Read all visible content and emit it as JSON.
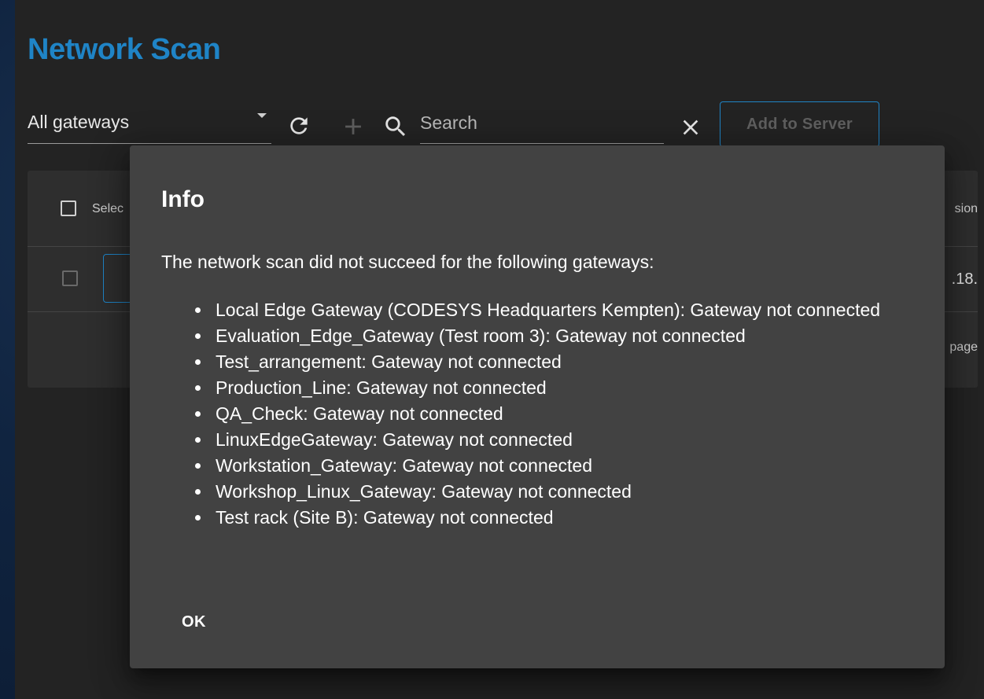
{
  "page": {
    "title": "Network Scan"
  },
  "toolbar": {
    "gateway_filter": "All gateways",
    "search_placeholder": "Search",
    "add_to_server_label": "Add to Server",
    "icons": [
      "refresh-icon",
      "add-icon",
      "search-icon",
      "close-icon",
      "chevron-down-icon"
    ]
  },
  "table": {
    "header_select_label": "Selec",
    "header_version_label": "sion",
    "row_version_value": ".18.",
    "footer_page_label": "page"
  },
  "dialog": {
    "title": "Info",
    "message": "The network scan did not succeed for the following gateways:",
    "items": [
      "Local Edge Gateway (CODESYS Headquarters Kempten): Gateway not connected",
      "Evaluation_Edge_Gateway (Test room 3): Gateway not connected",
      "Test_arrangement: Gateway not connected",
      "Production_Line: Gateway not connected",
      "QA_Check: Gateway not connected",
      "LinuxEdgeGateway: Gateway not connected",
      "Workstation_Gateway: Gateway not connected",
      "Workshop_Linux_Gateway: Gateway not connected",
      "Test rack (Site B): Gateway not connected"
    ],
    "ok_label": "OK"
  },
  "colors": {
    "accent": "#1f84c6",
    "panel_bg": "#232323",
    "dialog_bg": "#424242",
    "table_bg": "#2e2e2e"
  }
}
